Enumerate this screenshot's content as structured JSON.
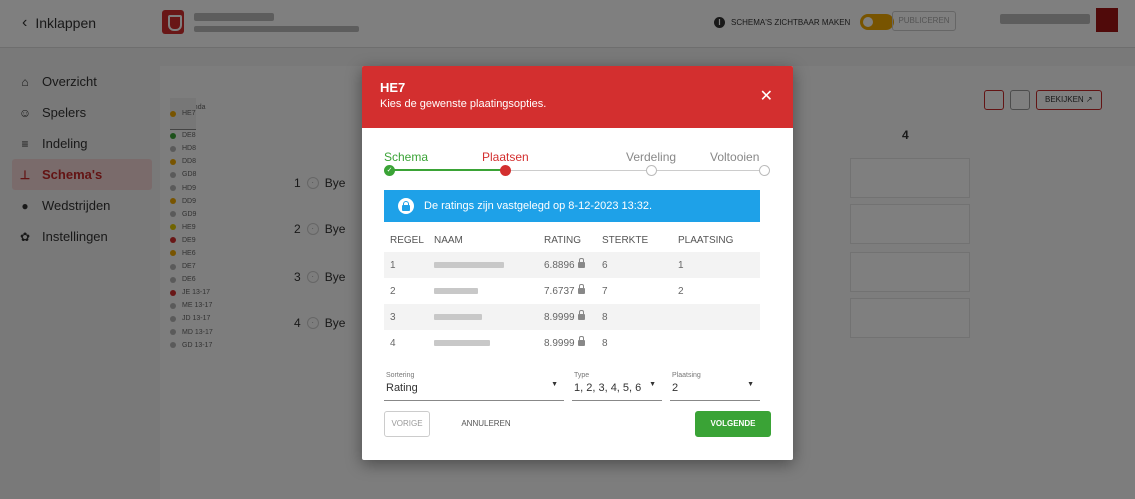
{
  "topbar": {
    "collapse_label": "Inklappen",
    "schema_visible_label": "SCHEMA'S ZICHTBAAR MAKEN",
    "publish_label": "PUBLICEREN"
  },
  "sidebar": {
    "items": [
      {
        "label": "Overzicht",
        "icon": "home-icon"
      },
      {
        "label": "Spelers",
        "icon": "users-icon"
      },
      {
        "label": "Indeling",
        "icon": "list-icon"
      },
      {
        "label": "Schema's",
        "icon": "bracket-icon"
      },
      {
        "label": "Wedstrijden",
        "icon": "ball-icon"
      },
      {
        "label": "Instellingen",
        "icon": "gear-icon"
      }
    ]
  },
  "legend": {
    "title": "Legenda",
    "items": [
      {
        "label": "HE8",
        "color": "#b5b5b5"
      },
      {
        "label": "DE8",
        "color": "#3aa336"
      },
      {
        "label": "HD8",
        "color": "#b5b5b5"
      },
      {
        "label": "DD8",
        "color": "#f0a800"
      },
      {
        "label": "GD8",
        "color": "#b5b5b5"
      },
      {
        "label": "HD9",
        "color": "#b5b5b5"
      },
      {
        "label": "DD9",
        "color": "#f0a800"
      },
      {
        "label": "GD9",
        "color": "#b5b5b5"
      },
      {
        "label": "HE9",
        "color": "#e0c800"
      },
      {
        "label": "DE9",
        "color": "#d32f2f"
      },
      {
        "label": "HE6",
        "color": "#f0a800"
      },
      {
        "label": "HE7",
        "color": "#f0a800"
      },
      {
        "label": "DE7",
        "color": "#b5b5b5"
      },
      {
        "label": "DE6",
        "color": "#b5b5b5"
      },
      {
        "label": "JE 13-17",
        "color": "#d32f2f"
      },
      {
        "label": "ME 13-17",
        "color": "#b5b5b5"
      },
      {
        "label": "JD 13-17",
        "color": "#b5b5b5"
      },
      {
        "label": "MD 13-17",
        "color": "#b5b5b5"
      },
      {
        "label": "GD 13-17",
        "color": "#b5b5b5"
      }
    ]
  },
  "bracket": {
    "rounds": [
      {
        "num": "1",
        "label": "Bye"
      },
      {
        "num": "2",
        "label": "Bye"
      },
      {
        "num": "3",
        "label": "Bye"
      },
      {
        "num": "4",
        "label": "Bye"
      }
    ],
    "column_header": "4",
    "view_button": "BEKIJKEN"
  },
  "modal": {
    "title": "HE7",
    "subtitle": "Kies de gewenste plaatingsopties.",
    "steps": [
      {
        "label": "Schema",
        "state": "done"
      },
      {
        "label": "Plaatsen",
        "state": "current"
      },
      {
        "label": "Verdeling",
        "state": "todo"
      },
      {
        "label": "Voltooien",
        "state": "todo"
      }
    ],
    "banner": "De ratings zijn vastgelegd op 8-12-2023 13:32.",
    "table": {
      "headers": [
        "REGEL",
        "NAAM",
        "RATING",
        "STERKTE",
        "PLAATSING"
      ],
      "rows": [
        {
          "regel": "1",
          "rating": "6.8896",
          "sterkte": "6",
          "plaatsing": "1"
        },
        {
          "regel": "2",
          "rating": "7.6737",
          "sterkte": "7",
          "plaatsing": "2"
        },
        {
          "regel": "3",
          "rating": "8.9999",
          "sterkte": "8",
          "plaatsing": ""
        },
        {
          "regel": "4",
          "rating": "8.9999",
          "sterkte": "8",
          "plaatsing": ""
        }
      ]
    },
    "selects": {
      "sortering": {
        "label": "Sortering",
        "value": "Rating"
      },
      "type": {
        "label": "Type",
        "value": "1, 2, 3, 4, 5, 6"
      },
      "plaatsing": {
        "label": "Plaatsing",
        "value": "2"
      }
    },
    "buttons": {
      "prev": "VORIGE",
      "cancel": "ANNULEREN",
      "next": "VOLGENDE"
    }
  },
  "colors": {
    "brand_red": "#d32f2f",
    "success_green": "#3aa336",
    "info_blue": "#1ea1e8",
    "toggle_orange": "#f0a800"
  }
}
